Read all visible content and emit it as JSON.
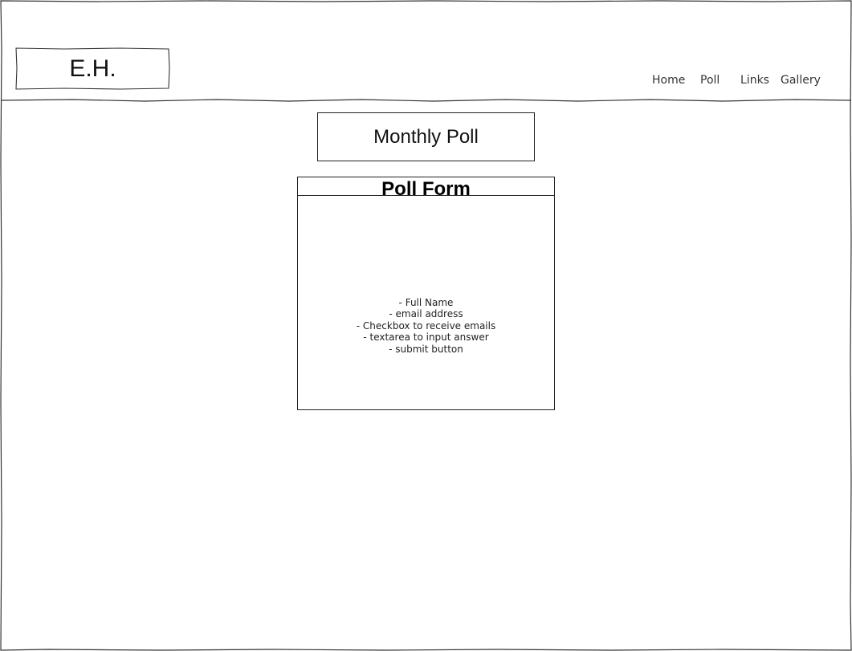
{
  "header": {
    "logo_text": "E.H.",
    "nav": [
      {
        "label": "Home"
      },
      {
        "label": "Poll"
      },
      {
        "label": "Links"
      },
      {
        "label": "Gallery"
      }
    ]
  },
  "main": {
    "title": "Monthly Poll",
    "form": {
      "title": "Poll Form",
      "fields": [
        "- Full Name",
        "- email address",
        "- Checkbox to receive emails",
        "- textarea to input answer",
        "- submit button"
      ]
    }
  }
}
